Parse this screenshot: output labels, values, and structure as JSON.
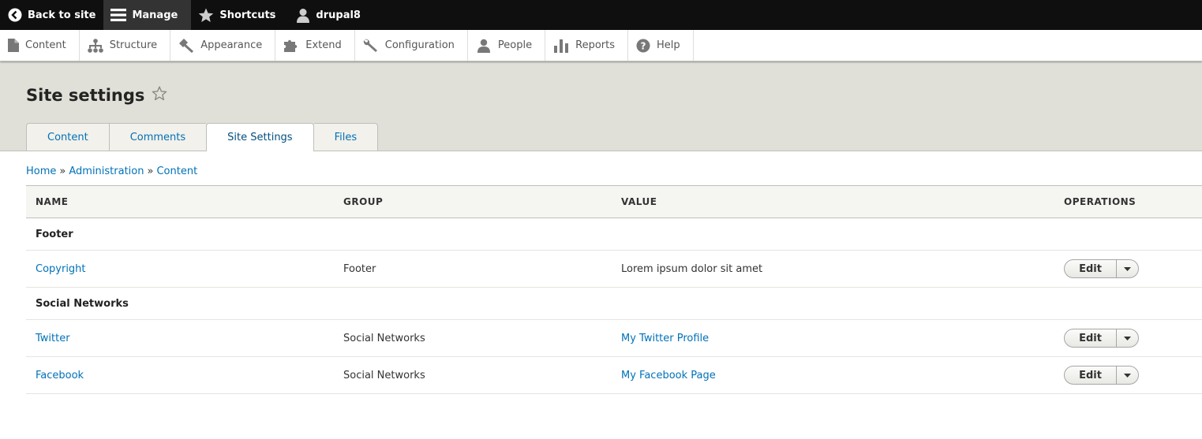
{
  "toolbar": {
    "back_label": "Back to site",
    "manage_label": "Manage",
    "shortcuts_label": "Shortcuts",
    "user_label": "drupal8"
  },
  "tray": {
    "items": [
      {
        "label": "Content",
        "icon": "file-icon"
      },
      {
        "label": "Structure",
        "icon": "sitemap-icon"
      },
      {
        "label": "Appearance",
        "icon": "paint-icon"
      },
      {
        "label": "Extend",
        "icon": "puzzle-icon"
      },
      {
        "label": "Configuration",
        "icon": "wrench-icon"
      },
      {
        "label": "People",
        "icon": "person-icon"
      },
      {
        "label": "Reports",
        "icon": "bar-chart-icon"
      },
      {
        "label": "Help",
        "icon": "help-icon"
      }
    ]
  },
  "header": {
    "title": "Site settings",
    "tabs": [
      "Content",
      "Comments",
      "Site Settings",
      "Files"
    ],
    "active_tab": "Site Settings"
  },
  "breadcrumb": {
    "items": [
      "Home",
      "Administration",
      "Content"
    ],
    "separator": "»"
  },
  "table": {
    "columns": [
      "NAME",
      "GROUP",
      "VALUE",
      "OPERATIONS"
    ],
    "groups": [
      {
        "title": "Footer",
        "rows": [
          {
            "name": "Copyright",
            "group": "Footer",
            "value": "Lorem ipsum dolor sit amet",
            "value_is_link": false,
            "op": "Edit"
          }
        ]
      },
      {
        "title": "Social Networks",
        "rows": [
          {
            "name": "Twitter",
            "group": "Social Networks",
            "value": "My Twitter Profile",
            "value_is_link": true,
            "op": "Edit"
          },
          {
            "name": "Facebook",
            "group": "Social Networks",
            "value": "My Facebook Page",
            "value_is_link": true,
            "op": "Edit"
          }
        ]
      }
    ]
  },
  "colors": {
    "link": "#0071b8",
    "toolbar_bg": "#0f0f0f",
    "header_bg": "#e0e0d8"
  }
}
